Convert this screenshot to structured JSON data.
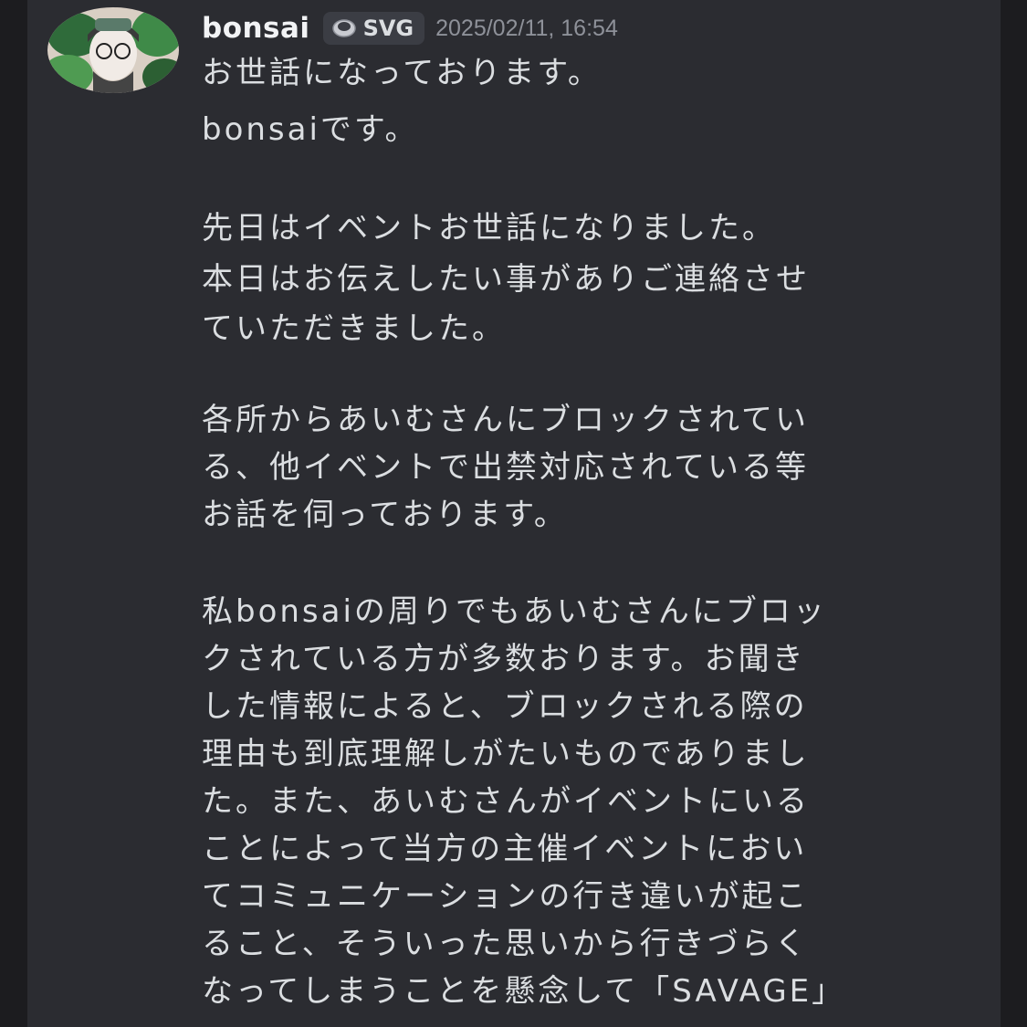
{
  "message": {
    "author": "bonsai",
    "tag": {
      "label": "SVG",
      "icon": "tag-badge-icon"
    },
    "timestamp": "2025/02/11, 16:54",
    "lines": [
      "お世話になっております。",
      "bonsaiです。",
      "先日はイベントお世話になりました。",
      "本日はお伝えしたい事がありご連絡させ",
      "ていただきました。",
      "各所からあいむさんにブロックされてい",
      "る、他イベントで出禁対応されている等",
      "お話を伺っております。",
      "私bonsaiの周りでもあいむさんにブロッ",
      "クされている方が多数おります。お聞き",
      "した情報によると、ブロックされる際の",
      "理由も到底理解しがたいものでありまし",
      "た。また、あいむさんがイベントにいる",
      "ことによって当方の主催イベントにおい",
      "てコミュニケーションの行き違いが起こ",
      "ること、そういった思いから行きづらく",
      "なってしまうことを懸念して「SAVAGE」"
    ]
  },
  "colors": {
    "background": "#1c1c1f",
    "message_background": "#2b2c31",
    "text": "#dbdee1",
    "author": "#f2f3f5",
    "timestamp": "#8e9199",
    "tag_background": "#3b3d44"
  }
}
